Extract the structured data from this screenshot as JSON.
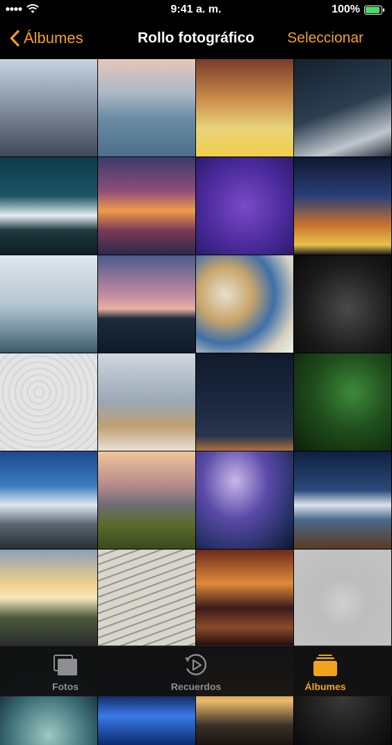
{
  "status": {
    "time": "9:41 a. m.",
    "battery": "100%",
    "battery_level": 1.0
  },
  "nav": {
    "back_label": "Álbumes",
    "title": "Rollo fotográfico",
    "select_label": "Seleccionar"
  },
  "colors": {
    "accent": "#f2a31c",
    "inactive": "#8e8e93"
  },
  "photos": [
    {
      "name": "city-street-blur-photo"
    },
    {
      "name": "lake-rocks-photo"
    },
    {
      "name": "retro-pixel-building-photo"
    },
    {
      "name": "night-road-photo"
    },
    {
      "name": "starry-mountains-photo"
    },
    {
      "name": "sunset-deer-illustration-photo"
    },
    {
      "name": "purple-triangle-logo-photo"
    },
    {
      "name": "times-square-photo"
    },
    {
      "name": "misty-mountains-photo"
    },
    {
      "name": "twilight-lake-photo"
    },
    {
      "name": "fractal-circles-photo"
    },
    {
      "name": "geometric-deer-photo"
    },
    {
      "name": "paisley-pattern-photo"
    },
    {
      "name": "window-blinds-glass-photo"
    },
    {
      "name": "dark-stage-photo"
    },
    {
      "name": "green-leaf-photo"
    },
    {
      "name": "snowy-peak-clouds-photo"
    },
    {
      "name": "autumn-hills-photo"
    },
    {
      "name": "planet-swirl-photo"
    },
    {
      "name": "mountain-pier-night-photo"
    },
    {
      "name": "sunset-highway-photo"
    },
    {
      "name": "wave-pattern-photo"
    },
    {
      "name": "car-mirror-sunset-photo"
    },
    {
      "name": "wireframe-sphere-photo"
    },
    {
      "name": "earth-globe-photo"
    },
    {
      "name": "blue-waves-abstract-photo"
    },
    {
      "name": "golden-mountains-photo"
    },
    {
      "name": "geometric-deer-2-photo"
    }
  ],
  "tabs": [
    {
      "label": "Fotos",
      "icon": "photos-stack-icon",
      "active": false
    },
    {
      "label": "Recuerdos",
      "icon": "memories-play-icon",
      "active": false
    },
    {
      "label": "Álbumes",
      "icon": "albums-icon",
      "active": true
    }
  ]
}
